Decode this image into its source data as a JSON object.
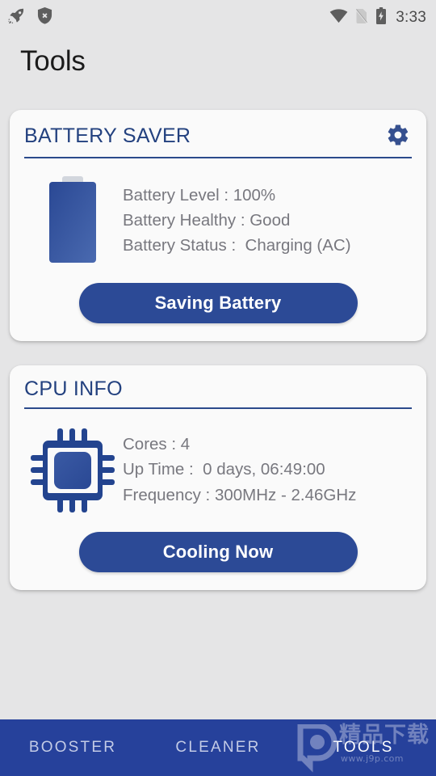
{
  "status_bar": {
    "left_icons": [
      {
        "name": "rocket-icon"
      },
      {
        "name": "shield-x-icon"
      }
    ],
    "right_icons": [
      {
        "name": "wifi-icon"
      },
      {
        "name": "sim-card-off-icon"
      },
      {
        "name": "battery-charging-icon"
      }
    ],
    "time": "3:33"
  },
  "header": {
    "title": "Tools"
  },
  "cards": [
    {
      "id": "battery-saver",
      "title": "BATTERY SAVER",
      "settings_icon": "gear-icon",
      "icon": "battery-full-icon",
      "lines": [
        "Battery Level : 100%",
        "Battery Healthy : Good",
        "Battery Status :  Charging (AC)"
      ],
      "action_label": "Saving Battery"
    },
    {
      "id": "cpu-info",
      "title": "CPU INFO",
      "icon": "cpu-chip-icon",
      "lines": [
        "Cores : 4",
        "Up Time :  0 days, 06:49:00",
        "Frequency : 300MHz - 2.46GHz"
      ],
      "action_label": "Cooling Now"
    }
  ],
  "bottom_nav": {
    "items": [
      {
        "label": "BOOSTER",
        "active": false
      },
      {
        "label": "CLEANER",
        "active": false
      },
      {
        "label": "TOOLS",
        "active": true
      }
    ]
  },
  "watermark": {
    "text_cn": "精品下载",
    "url": "www.j9p.com",
    "logo": "p-bubble-logo"
  },
  "colors": {
    "page_background": "#e5e5e6",
    "card_background": "#fafafa",
    "accent_blue": "#2c4a96",
    "nav_blue": "#26419b",
    "title_blue": "#23417f",
    "info_gray": "#78787f"
  }
}
